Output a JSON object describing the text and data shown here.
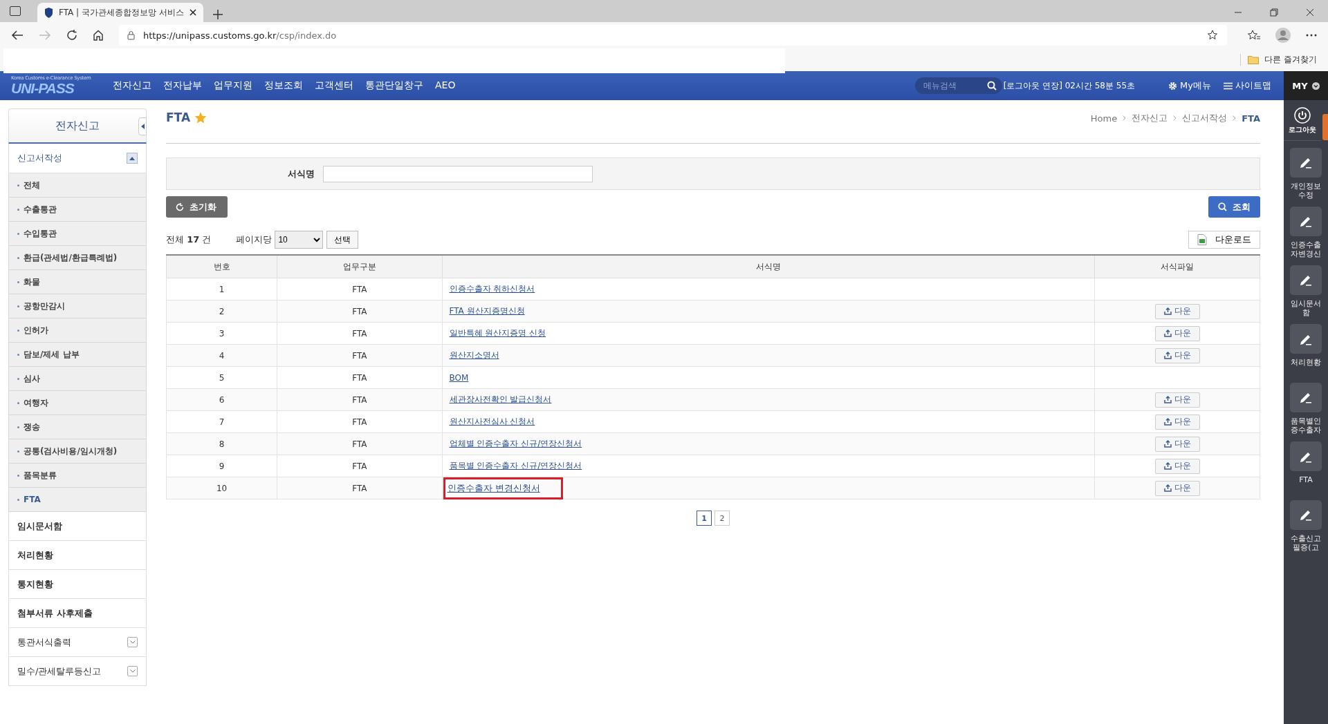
{
  "browser": {
    "tab_title": "FTA | 국가관세종합정보망 서비스",
    "url_host": "https://unipass.customs.go.kr",
    "url_path": "/csp/index.do",
    "bookmark": "다른 즐겨찾기"
  },
  "header": {
    "logo_caption": "Korea Customs e-Clearance System",
    "logo": "UNI-PASS",
    "menu": [
      "전자신고",
      "전자납부",
      "업무지원",
      "정보조회",
      "고객센터",
      "통관단일창구",
      "AEO"
    ],
    "search": {
      "placeholder": "메뉴검색"
    },
    "session": "[로그아웃 연장] 02시간 58분 55초",
    "my_menu": "My메뉴",
    "sitemap": "사이트맵",
    "my": "MY"
  },
  "sidebar": {
    "title": "전자신고",
    "section": {
      "label": "신고서작성",
      "expanded": true,
      "items": [
        {
          "label": "전체",
          "selected": false
        },
        {
          "label": "수출통관",
          "selected": false
        },
        {
          "label": "수입통관",
          "selected": false
        },
        {
          "label": "환급(관세법/환급특례법)",
          "selected": false
        },
        {
          "label": "화물",
          "selected": false
        },
        {
          "label": "공항만감시",
          "selected": false
        },
        {
          "label": "인허가",
          "selected": false
        },
        {
          "label": "담보/제세 납부",
          "selected": false
        },
        {
          "label": "심사",
          "selected": false
        },
        {
          "label": "여행자",
          "selected": false
        },
        {
          "label": "쟁송",
          "selected": false
        },
        {
          "label": "공통(검사비용/임시개청)",
          "selected": false
        },
        {
          "label": "품목분류",
          "selected": false
        },
        {
          "label": "FTA",
          "selected": true
        }
      ]
    },
    "items": [
      {
        "label": "임시문서함",
        "kind": "link"
      },
      {
        "label": "처리현황",
        "kind": "link"
      },
      {
        "label": "통지현황",
        "kind": "link"
      },
      {
        "label": "첨부서류 사후제출",
        "kind": "link"
      },
      {
        "label": "통관서식출력",
        "kind": "dropdown"
      },
      {
        "label": "밀수/관세탈루등신고",
        "kind": "dropdown"
      }
    ]
  },
  "page": {
    "title": "FTA",
    "favorite": true,
    "breadcrumb": [
      "Home",
      "전자신고",
      "신고서작성",
      "FTA"
    ],
    "search_label": "서식명",
    "reset_button": "초기화",
    "search_button": "조회",
    "total_prefix": "전체",
    "total": "17",
    "total_suffix": "건",
    "per_page_label": "페이지당",
    "per_page": "10",
    "select_button": "선택",
    "download_button": "다운로드"
  },
  "table": {
    "columns": [
      "번호",
      "업무구분",
      "서식명",
      "서식파일"
    ],
    "rows": [
      {
        "no": "1",
        "category": "FTA",
        "form": "인증수출자 취하신청서",
        "file": null,
        "highlighted": false
      },
      {
        "no": "2",
        "category": "FTA",
        "form": "FTA 원산지증명신청",
        "file": "다운",
        "highlighted": false
      },
      {
        "no": "3",
        "category": "FTA",
        "form": "일반특혜 원산지증명 신청",
        "file": "다운",
        "highlighted": false
      },
      {
        "no": "4",
        "category": "FTA",
        "form": "원산지소명서",
        "file": "다운",
        "highlighted": false
      },
      {
        "no": "5",
        "category": "FTA",
        "form": "BOM",
        "file": null,
        "highlighted": false
      },
      {
        "no": "6",
        "category": "FTA",
        "form": "세관장사전확인 발급신청서",
        "file": "다운",
        "highlighted": false
      },
      {
        "no": "7",
        "category": "FTA",
        "form": "원산지사전심사 신청서",
        "file": "다운",
        "highlighted": false
      },
      {
        "no": "8",
        "category": "FTA",
        "form": "업체별 인증수출자 신규/연장신청서",
        "file": "다운",
        "highlighted": false
      },
      {
        "no": "9",
        "category": "FTA",
        "form": "품목별 인증수출자 신규/연장신청서",
        "file": "다운",
        "highlighted": false
      },
      {
        "no": "10",
        "category": "FTA",
        "form": "인증수출자 변경신청서",
        "file": "다운",
        "highlighted": true
      }
    ]
  },
  "pagination": [
    {
      "label": "1",
      "selected": true
    },
    {
      "label": "2",
      "selected": false
    }
  ],
  "quick_panel": {
    "logout": "로그아웃",
    "items": [
      "개인정보수정",
      "인증수출자변경신",
      "임시문서함",
      "처리현황",
      "품목별인증수출자",
      "FTA",
      "수출신고필증(고"
    ]
  }
}
